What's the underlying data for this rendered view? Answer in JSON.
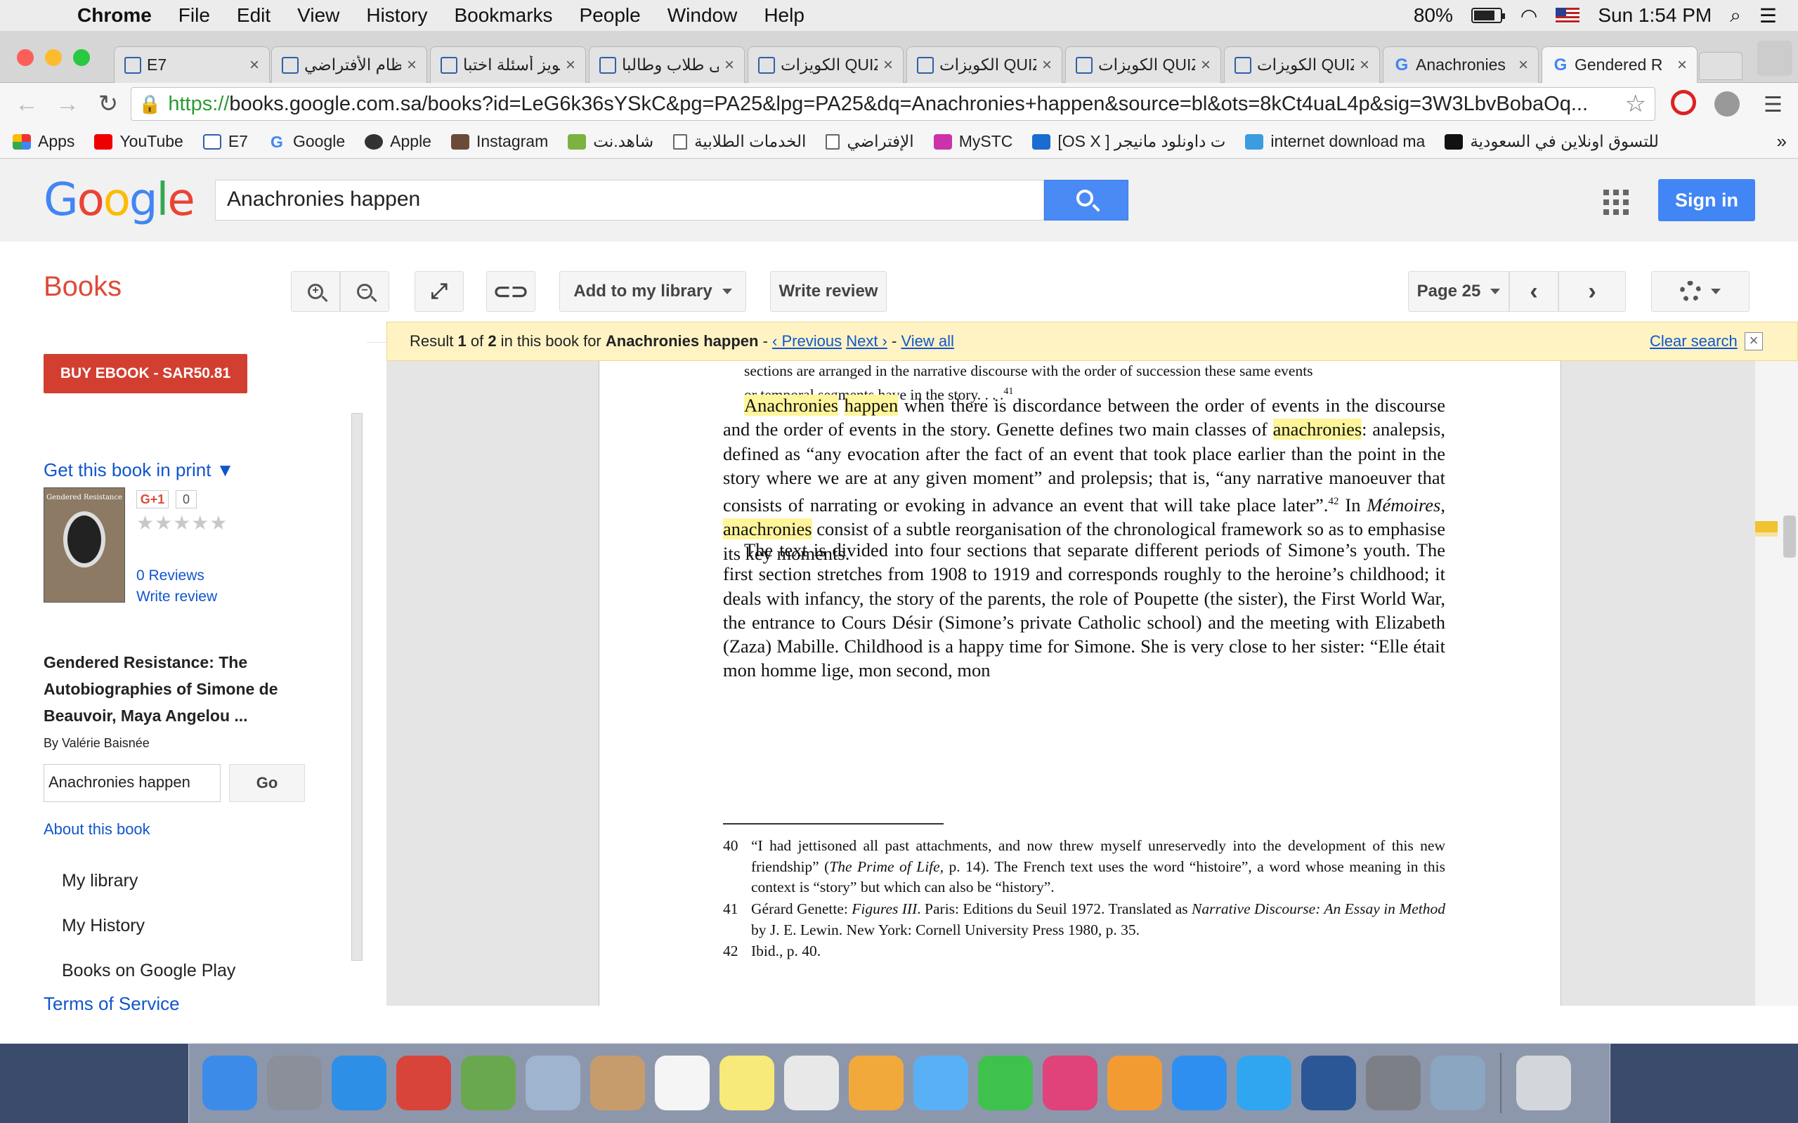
{
  "menubar": {
    "app": "Chrome",
    "items": [
      "File",
      "Edit",
      "View",
      "History",
      "Bookmarks",
      "People",
      "Window",
      "Help"
    ],
    "battery_label": "80%",
    "battery_level": 0.8,
    "clock": "Sun 1:54 PM"
  },
  "tabs": [
    {
      "label": "E7",
      "icon": "quiz-icon"
    },
    {
      "label": "ظام الأفتراضي",
      "icon": "quiz-icon"
    },
    {
      "label": "كويز أسئلة اختبا",
      "icon": "quiz-icon"
    },
    {
      "label": "قى طلاب وطالبا",
      "icon": "quiz-icon"
    },
    {
      "label": "الكويزات QUIZ",
      "icon": "quiz-icon"
    },
    {
      "label": "الكويزات QUIZ",
      "icon": "quiz-icon"
    },
    {
      "label": "الكويزات QUIZ",
      "icon": "quiz-icon"
    },
    {
      "label": "الكويزات QUIZ",
      "icon": "quiz-icon"
    },
    {
      "label": "Anachronies",
      "icon": "google-icon"
    },
    {
      "label": "Gendered R",
      "icon": "google-icon",
      "active": true
    }
  ],
  "address": {
    "scheme": "https://",
    "url": "books.google.com.sa/books?id=LeG6k36sYSkC&pg=PA25&lpg=PA25&dq=Anachronies+happen&source=bl&ots=8kCt4uaL4p&sig=3W3LbvBobaOq..."
  },
  "bookmarks": [
    {
      "label": "Apps",
      "icon": "apps-icon"
    },
    {
      "label": "YouTube",
      "icon": "youtube-icon"
    },
    {
      "label": "E7",
      "icon": "quiz-icon"
    },
    {
      "label": "Google",
      "icon": "google-icon"
    },
    {
      "label": "Apple",
      "icon": "apple-icon"
    },
    {
      "label": "Instagram",
      "icon": "instagram-icon"
    },
    {
      "label": "شاهد.نت",
      "icon": "shahid-icon"
    },
    {
      "label": "الخدمات الطلابية",
      "icon": "page-icon"
    },
    {
      "label": "الإفتراضي",
      "icon": "page-icon"
    },
    {
      "label": "MySTC",
      "icon": "mystc-icon"
    },
    {
      "label": "[OS X ] ت داونلود مانيجر",
      "icon": "osx-icon"
    },
    {
      "label": "internet download ma",
      "icon": "idm-icon"
    },
    {
      "label": "للتسوق اونلاين في السعودية",
      "icon": "n-icon"
    }
  ],
  "google": {
    "logo_letters": [
      "G",
      "o",
      "o",
      "g",
      "l",
      "e"
    ],
    "search_value": "Anachronies happen",
    "signin": "Sign in"
  },
  "books_toolbar": {
    "title": "Books",
    "add_library": "Add to my library",
    "write_review": "Write review",
    "page_label": "Page 25"
  },
  "sidebar": {
    "buy": "BUY EBOOK - SAR50.81",
    "get_print": "Get this book in print ▼",
    "cover_text": "Gendered Resistance",
    "gplus": "G+1",
    "gplus_count": "0",
    "rating": 0,
    "reviews": "0 Reviews",
    "write_review": "Write review",
    "title": "Gendered Resistance: The Autobiographies of Simone de Beauvoir, Maya Angelou ...",
    "author": "By Valérie Baisnée",
    "search_value": "Anachronies happen",
    "go": "Go",
    "about": "About this book",
    "nav": [
      "My library",
      "My History",
      "Books on Google Play"
    ],
    "terms": "Terms of Service"
  },
  "resultbar": {
    "prefix": "Result ",
    "current": "1",
    "of": " of ",
    "total": "2",
    "mid": " in this book for ",
    "query": "Anachronies happen",
    "dash1": " - ",
    "previous": "‹ Previous",
    "next": "Next ›",
    "dash2": " - ",
    "view_all": "View all",
    "clear": "Clear search",
    "close": "×"
  },
  "page": {
    "ext1": "sections are arranged in the narrative discourse with the order of succession these same events",
    "ext2": "or temporal segments have in the story. . . .",
    "ext2_sup": "41",
    "p1_hl1": "Anachronies",
    "p1_hl2": "happen",
    "p1_a": " when there is discordance between the order of events in the discourse and the order of events in the story. Genette defines two main classes of ",
    "p1_hl3": "anachronies",
    "p1_b": ": analepsis, defined as “any evocation after the fact of an event that took place earlier than the point in the story where we are at any given moment” and prolepsis; that is, “any narrative manoeuver that consists of narrating or evoking in advance an event that will take place later”.",
    "p1_sup": "42",
    "p1_c": " In ",
    "p1_italic": "Mémoires",
    "p1_d": ", ",
    "p1_hl4": "anachronies",
    "p1_e": " consist of a subtle reorganisation of the chronological framework so as to emphasise its key moments.",
    "p2": "The text is divided into four sections that separate different periods of Simone’s youth. The first section stretches from 1908 to 1919 and corresponds roughly to the heroine’s childhood; it deals with infancy, the story of the parents, the role of Poupette (the sister), the First World War, the entrance to Cours Désir (Simone’s private Catholic school) and the meeting with Elizabeth (Zaza) Mabille. Childhood is a happy time for Simone. She is very close to her sister: “Elle était mon homme lige, mon second, mon",
    "fn40_num": "40",
    "fn40_a": "“I had jettisoned all past attachments, and now threw myself unreservedly into the development of this new friendship” (",
    "fn40_italic": "The Prime of Life",
    "fn40_b": ", p. 14). The French text uses the word “histoire”, a word whose meaning in this context is “story” but which can also be “history”.",
    "fn41_num": "41",
    "fn41_a": "Gérard Genette: ",
    "fn41_italic1": "Figures III",
    "fn41_b": ". Paris: Editions du Seuil 1972. Translated as ",
    "fn41_italic2": "Narrative Discourse: An Essay in Method",
    "fn41_c": " by J. E. Lewin. New York: Cornell University Press 1980, p. 35.",
    "fn42_num": "42",
    "fn42": "Ibid., p. 40."
  },
  "dock": [
    {
      "name": "finder-icon",
      "color": "#3d8be8"
    },
    {
      "name": "launchpad-icon",
      "color": "#8a8f99"
    },
    {
      "name": "safari-icon",
      "color": "#2e8fe6"
    },
    {
      "name": "chrome-icon",
      "color": "#d9443a"
    },
    {
      "name": "web-app-icon",
      "color": "#6aa84f"
    },
    {
      "name": "mail-icon",
      "color": "#9fb4cf"
    },
    {
      "name": "contacts-icon",
      "color": "#c69c6d"
    },
    {
      "name": "calendar-icon",
      "color": "#f5f5f5"
    },
    {
      "name": "notes-icon",
      "color": "#f7e97a"
    },
    {
      "name": "reminders-icon",
      "color": "#e8e8e8"
    },
    {
      "name": "photos-icon",
      "color": "#f2a93b"
    },
    {
      "name": "messages-icon",
      "color": "#5ab0f5"
    },
    {
      "name": "facetime-icon",
      "color": "#3fc14e"
    },
    {
      "name": "itunes-icon",
      "color": "#e0427a"
    },
    {
      "name": "ibooks-icon",
      "color": "#f29b32"
    },
    {
      "name": "app-store-icon",
      "color": "#2f8ff0"
    },
    {
      "name": "twitter-icon",
      "color": "#31a6f0"
    },
    {
      "name": "word-icon",
      "color": "#2b5797"
    },
    {
      "name": "system-preferences-icon",
      "color": "#7c7f85"
    },
    {
      "name": "preview-icon",
      "color": "#8aa6c1"
    },
    {
      "name": "trash-icon",
      "color": "#d3d6da"
    }
  ]
}
